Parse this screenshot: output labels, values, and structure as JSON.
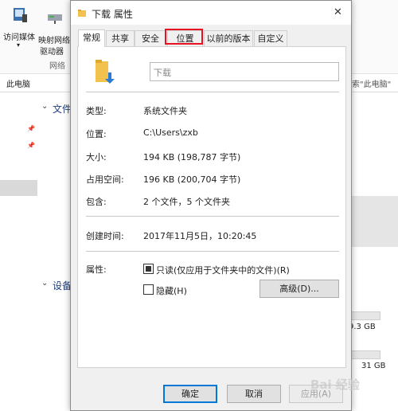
{
  "explorer": {
    "ribbon_visit_media": "访问媒体",
    "ribbon_map_network_1": "映射网络",
    "ribbon_map_network_2": "驱动器",
    "ribbon_group_network": "网络",
    "address": "此电脑",
    "search_hint": "索\"此电脑\"",
    "section_folders": "文件",
    "section_devices": "设备",
    "drive1_size": "9.3 GB",
    "drive2_size": "31 GB",
    "pin_glyph": "📌"
  },
  "dialog": {
    "title": "下载 属性",
    "close_glyph": "✕",
    "tabs": [
      "常规",
      "共享",
      "安全",
      "位置",
      "以前的版本",
      "自定义"
    ],
    "highlight_color": "#e81123",
    "name_value": "下载",
    "fields": [
      {
        "label": "类型:",
        "value": "系统文件夹"
      },
      {
        "label": "位置:",
        "value": "C:\\Users\\zxb"
      },
      {
        "label": "大小:",
        "value": "194 KB (198,787 字节)"
      },
      {
        "label": "占用空间:",
        "value": "196 KB (200,704 字节)"
      },
      {
        "label": "包含:",
        "value": "2 个文件，5 个文件夹"
      }
    ],
    "created_label": "创建时间:",
    "created_value": "2017年11月5日，10:20:45",
    "attributes_label": "属性:",
    "readonly_label": "只读(仅应用于文件夹中的文件)(R)",
    "hidden_label": "隐藏(H)",
    "advanced_button": "高级(D)...",
    "ok_button": "确定",
    "cancel_button": "取消",
    "apply_button": "应用(A)"
  },
  "watermark": "Bai 经验"
}
